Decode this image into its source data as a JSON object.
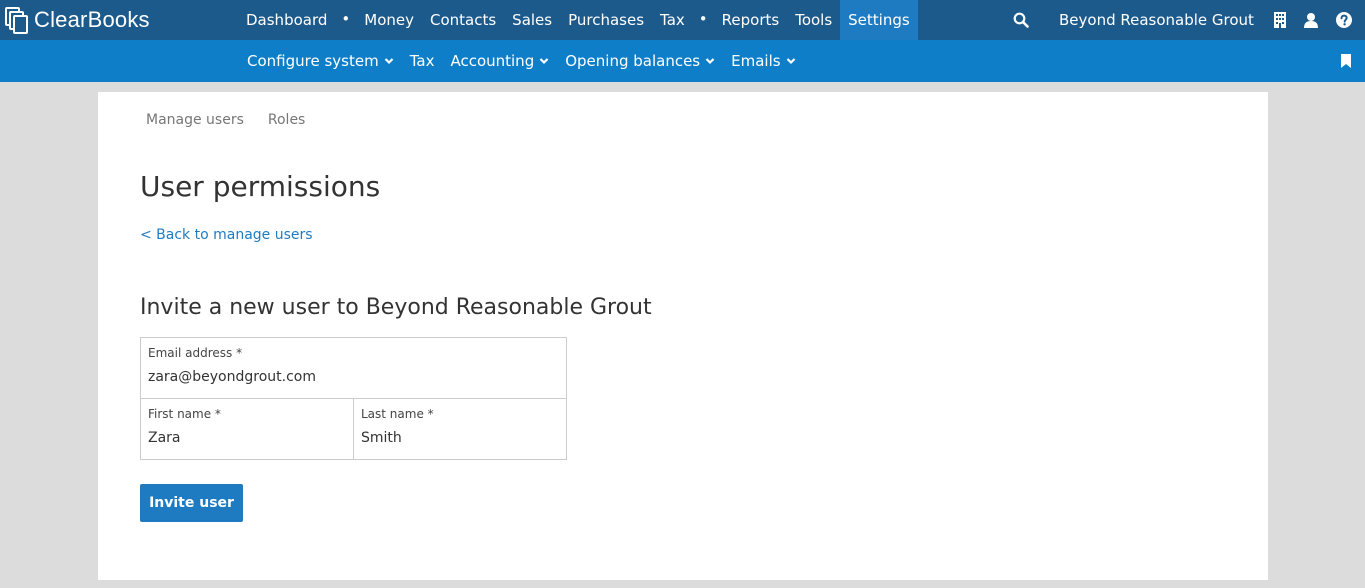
{
  "app": {
    "name": "ClearBooks"
  },
  "main_nav": [
    {
      "label": "Dashboard"
    },
    {
      "label": "Money"
    },
    {
      "label": "Contacts"
    },
    {
      "label": "Sales"
    },
    {
      "label": "Purchases"
    },
    {
      "label": "Tax"
    },
    {
      "label": "Reports"
    },
    {
      "label": "Tools"
    },
    {
      "label": "Settings",
      "active": true
    }
  ],
  "org_name": "Beyond Reasonable Grout",
  "sub_nav": [
    {
      "label": "Configure system",
      "dropdown": true
    },
    {
      "label": "Tax",
      "dropdown": false
    },
    {
      "label": "Accounting",
      "dropdown": true
    },
    {
      "label": "Opening balances",
      "dropdown": true
    },
    {
      "label": "Emails",
      "dropdown": true
    }
  ],
  "tabs": [
    {
      "label": "Manage users"
    },
    {
      "label": "Roles"
    }
  ],
  "page": {
    "title": "User permissions",
    "back_link": "< Back to manage users",
    "section_title": "Invite a new user to Beyond Reasonable Grout"
  },
  "form": {
    "email": {
      "label": "Email address *",
      "value": "zara@beyondgrout.com"
    },
    "first_name": {
      "label": "First name *",
      "value": "Zara"
    },
    "last_name": {
      "label": "Last name *",
      "value": "Smith"
    },
    "submit_label": "Invite user"
  },
  "icons": {
    "search": "search-icon",
    "building": "building-icon",
    "user": "user-icon",
    "help": "help-icon",
    "bookmark": "bookmark-icon",
    "chevron": "chevron-down-icon"
  },
  "colors": {
    "topbar": "#1d5a8c",
    "subbar": "#0f7ec8",
    "accent": "#1f7bc1",
    "background": "#dcdcdc"
  }
}
